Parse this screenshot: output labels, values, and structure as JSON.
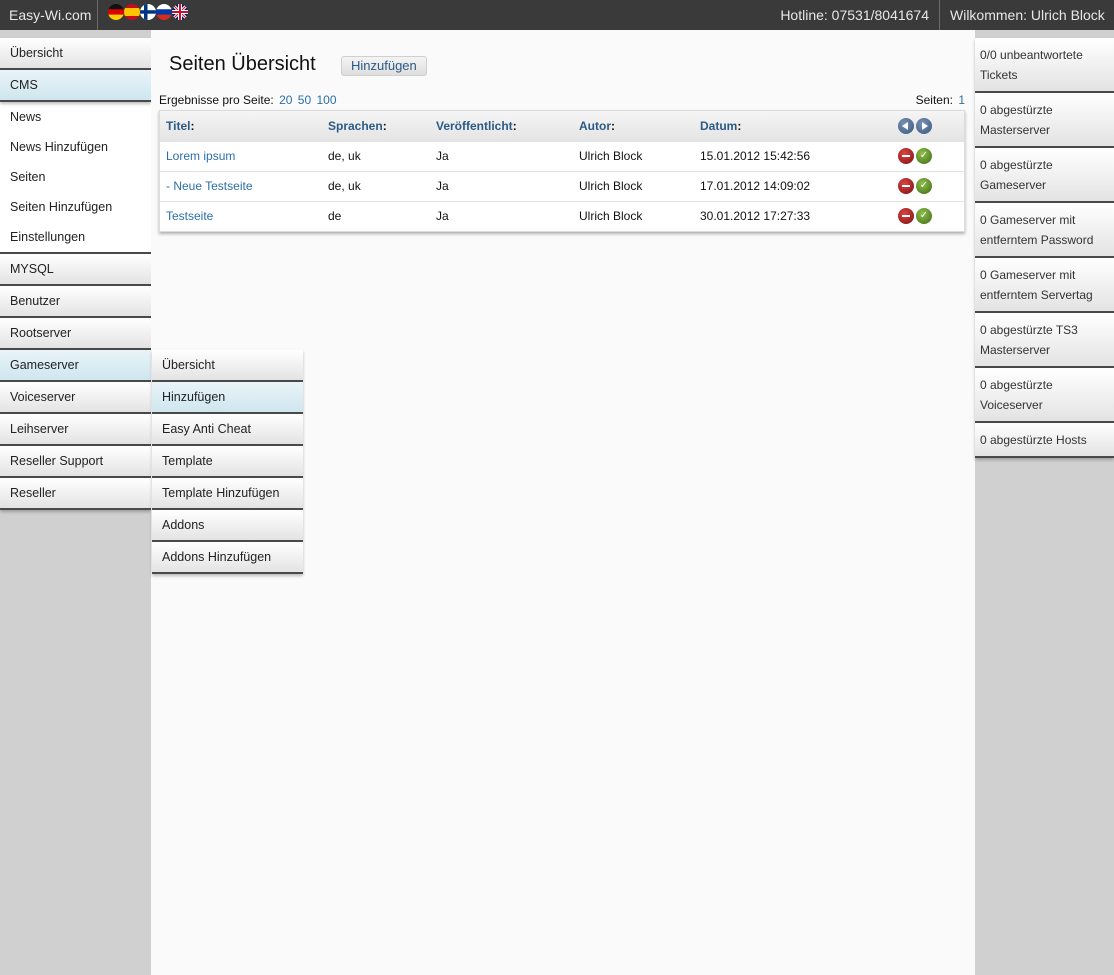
{
  "topbar": {
    "brand": "Easy-Wi.com",
    "flags": [
      "de",
      "es",
      "fi",
      "ru",
      "uk"
    ],
    "hotline": "Hotline: 07531/8041674",
    "welcome": "Wilkommen: Ulrich Block"
  },
  "leftnav": {
    "items": [
      {
        "label": "Übersicht"
      },
      {
        "label": "CMS"
      },
      {
        "label": "MYSQL"
      },
      {
        "label": "Benutzer"
      },
      {
        "label": "Rootserver"
      },
      {
        "label": "Gameserver"
      },
      {
        "label": "Voiceserver"
      },
      {
        "label": "Leihserver"
      },
      {
        "label": "Reseller Support"
      },
      {
        "label": "Reseller"
      }
    ],
    "cms_sub": [
      {
        "label": "News"
      },
      {
        "label": "News Hinzufügen"
      },
      {
        "label": "Seiten"
      },
      {
        "label": "Seiten Hinzufügen"
      },
      {
        "label": "Einstellungen"
      }
    ]
  },
  "flyout": {
    "items": [
      {
        "label": "Übersicht"
      },
      {
        "label": "Hinzufügen"
      },
      {
        "label": "Easy Anti Cheat"
      },
      {
        "label": "Template"
      },
      {
        "label": "Template Hinzufügen"
      },
      {
        "label": "Addons"
      },
      {
        "label": "Addons Hinzufügen"
      }
    ]
  },
  "main": {
    "title": "Seiten Übersicht",
    "add_label": "Hinzufügen",
    "perpage_label": "Ergebnisse pro Seite:",
    "perpage_options": [
      "20",
      "50",
      "100"
    ],
    "pages_label": "Seiten:",
    "pages_current": "1",
    "columns": [
      "Titel",
      "Sprachen",
      "Veröffentlicht",
      "Autor",
      "Datum"
    ],
    "rows": [
      {
        "title": "Lorem ipsum",
        "langs": "de, uk",
        "published": "Ja",
        "author": "Ulrich Block",
        "date": "15.01.2012 15:42:56"
      },
      {
        "title": "- Neue Testseite",
        "langs": "de, uk",
        "published": "Ja",
        "author": "Ulrich Block",
        "date": "17.01.2012 14:09:02"
      },
      {
        "title": "Testseite",
        "langs": "de",
        "published": "Ja",
        "author": "Ulrich Block",
        "date": "30.01.2012 17:27:33"
      }
    ]
  },
  "rightnav": {
    "items": [
      {
        "label": "0/0 unbeantwortete Tickets"
      },
      {
        "label": "0 abgestürzte Masterserver"
      },
      {
        "label": "0 abgestürzte Gameserver"
      },
      {
        "label": "0 Gameserver mit entferntem Password"
      },
      {
        "label": "0 Gameserver mit entferntem Servertag"
      },
      {
        "label": "0 abgestürzte TS3 Masterserver"
      },
      {
        "label": "0 abgestürzte Voiceserver"
      },
      {
        "label": "0 abgestürzte Hosts"
      }
    ]
  }
}
